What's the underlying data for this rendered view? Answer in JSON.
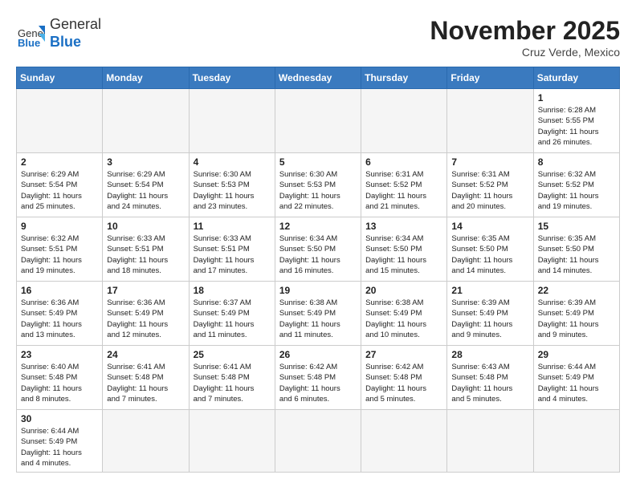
{
  "header": {
    "logo_general": "General",
    "logo_blue": "Blue",
    "month_title": "November 2025",
    "location": "Cruz Verde, Mexico"
  },
  "days_of_week": [
    "Sunday",
    "Monday",
    "Tuesday",
    "Wednesday",
    "Thursday",
    "Friday",
    "Saturday"
  ],
  "weeks": [
    [
      {
        "day": "",
        "info": ""
      },
      {
        "day": "",
        "info": ""
      },
      {
        "day": "",
        "info": ""
      },
      {
        "day": "",
        "info": ""
      },
      {
        "day": "",
        "info": ""
      },
      {
        "day": "",
        "info": ""
      },
      {
        "day": "1",
        "info": "Sunrise: 6:28 AM\nSunset: 5:55 PM\nDaylight: 11 hours\nand 26 minutes."
      }
    ],
    [
      {
        "day": "2",
        "info": "Sunrise: 6:29 AM\nSunset: 5:54 PM\nDaylight: 11 hours\nand 25 minutes."
      },
      {
        "day": "3",
        "info": "Sunrise: 6:29 AM\nSunset: 5:54 PM\nDaylight: 11 hours\nand 24 minutes."
      },
      {
        "day": "4",
        "info": "Sunrise: 6:30 AM\nSunset: 5:53 PM\nDaylight: 11 hours\nand 23 minutes."
      },
      {
        "day": "5",
        "info": "Sunrise: 6:30 AM\nSunset: 5:53 PM\nDaylight: 11 hours\nand 22 minutes."
      },
      {
        "day": "6",
        "info": "Sunrise: 6:31 AM\nSunset: 5:52 PM\nDaylight: 11 hours\nand 21 minutes."
      },
      {
        "day": "7",
        "info": "Sunrise: 6:31 AM\nSunset: 5:52 PM\nDaylight: 11 hours\nand 20 minutes."
      },
      {
        "day": "8",
        "info": "Sunrise: 6:32 AM\nSunset: 5:52 PM\nDaylight: 11 hours\nand 19 minutes."
      }
    ],
    [
      {
        "day": "9",
        "info": "Sunrise: 6:32 AM\nSunset: 5:51 PM\nDaylight: 11 hours\nand 19 minutes."
      },
      {
        "day": "10",
        "info": "Sunrise: 6:33 AM\nSunset: 5:51 PM\nDaylight: 11 hours\nand 18 minutes."
      },
      {
        "day": "11",
        "info": "Sunrise: 6:33 AM\nSunset: 5:51 PM\nDaylight: 11 hours\nand 17 minutes."
      },
      {
        "day": "12",
        "info": "Sunrise: 6:34 AM\nSunset: 5:50 PM\nDaylight: 11 hours\nand 16 minutes."
      },
      {
        "day": "13",
        "info": "Sunrise: 6:34 AM\nSunset: 5:50 PM\nDaylight: 11 hours\nand 15 minutes."
      },
      {
        "day": "14",
        "info": "Sunrise: 6:35 AM\nSunset: 5:50 PM\nDaylight: 11 hours\nand 14 minutes."
      },
      {
        "day": "15",
        "info": "Sunrise: 6:35 AM\nSunset: 5:50 PM\nDaylight: 11 hours\nand 14 minutes."
      }
    ],
    [
      {
        "day": "16",
        "info": "Sunrise: 6:36 AM\nSunset: 5:49 PM\nDaylight: 11 hours\nand 13 minutes."
      },
      {
        "day": "17",
        "info": "Sunrise: 6:36 AM\nSunset: 5:49 PM\nDaylight: 11 hours\nand 12 minutes."
      },
      {
        "day": "18",
        "info": "Sunrise: 6:37 AM\nSunset: 5:49 PM\nDaylight: 11 hours\nand 11 minutes."
      },
      {
        "day": "19",
        "info": "Sunrise: 6:38 AM\nSunset: 5:49 PM\nDaylight: 11 hours\nand 11 minutes."
      },
      {
        "day": "20",
        "info": "Sunrise: 6:38 AM\nSunset: 5:49 PM\nDaylight: 11 hours\nand 10 minutes."
      },
      {
        "day": "21",
        "info": "Sunrise: 6:39 AM\nSunset: 5:49 PM\nDaylight: 11 hours\nand 9 minutes."
      },
      {
        "day": "22",
        "info": "Sunrise: 6:39 AM\nSunset: 5:49 PM\nDaylight: 11 hours\nand 9 minutes."
      }
    ],
    [
      {
        "day": "23",
        "info": "Sunrise: 6:40 AM\nSunset: 5:48 PM\nDaylight: 11 hours\nand 8 minutes."
      },
      {
        "day": "24",
        "info": "Sunrise: 6:41 AM\nSunset: 5:48 PM\nDaylight: 11 hours\nand 7 minutes."
      },
      {
        "day": "25",
        "info": "Sunrise: 6:41 AM\nSunset: 5:48 PM\nDaylight: 11 hours\nand 7 minutes."
      },
      {
        "day": "26",
        "info": "Sunrise: 6:42 AM\nSunset: 5:48 PM\nDaylight: 11 hours\nand 6 minutes."
      },
      {
        "day": "27",
        "info": "Sunrise: 6:42 AM\nSunset: 5:48 PM\nDaylight: 11 hours\nand 5 minutes."
      },
      {
        "day": "28",
        "info": "Sunrise: 6:43 AM\nSunset: 5:48 PM\nDaylight: 11 hours\nand 5 minutes."
      },
      {
        "day": "29",
        "info": "Sunrise: 6:44 AM\nSunset: 5:49 PM\nDaylight: 11 hours\nand 4 minutes."
      }
    ],
    [
      {
        "day": "30",
        "info": "Sunrise: 6:44 AM\nSunset: 5:49 PM\nDaylight: 11 hours\nand 4 minutes."
      },
      {
        "day": "",
        "info": ""
      },
      {
        "day": "",
        "info": ""
      },
      {
        "day": "",
        "info": ""
      },
      {
        "day": "",
        "info": ""
      },
      {
        "day": "",
        "info": ""
      },
      {
        "day": "",
        "info": ""
      }
    ]
  ]
}
